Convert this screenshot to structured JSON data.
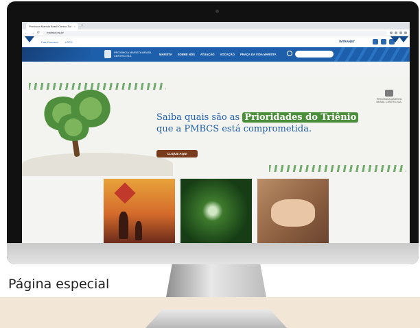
{
  "caption": "Página especial",
  "browser": {
    "tab_title": "Província Marista Brasil Centro-Sul",
    "tab_close": "×",
    "new_tab": "+",
    "url": "marista.org.br",
    "back_glyph": "←",
    "forward_glyph": "→",
    "reload_glyph": "⟳"
  },
  "site": {
    "top_links": [
      "Fale Conosco",
      "LGPD"
    ],
    "intranet_label": "INTRANET",
    "logo_text": "PROVÍNCIA MARISTA BRASIL CENTRO-SUL",
    "menu": [
      "MARISTA",
      "SOBRE NÓS",
      "ATUAÇÃO",
      "VOCAÇÃO",
      "PRAÇA DA VIDA MARISTA"
    ],
    "hero_line1_prefix": "Saiba quais são as",
    "hero_highlight": "Prioridades do Triênio",
    "hero_line2": "que a PMBCS está comprometida.",
    "cta_label": "CLIQUE AQUI",
    "corner_logo_text": "PROVÍNCIA MARISTA BRASIL CENTRO-SUL"
  },
  "colors": {
    "brand_blue": "#1d5faa",
    "highlight_green": "#4a8e3a",
    "cta_brown": "#7a3b1c"
  }
}
